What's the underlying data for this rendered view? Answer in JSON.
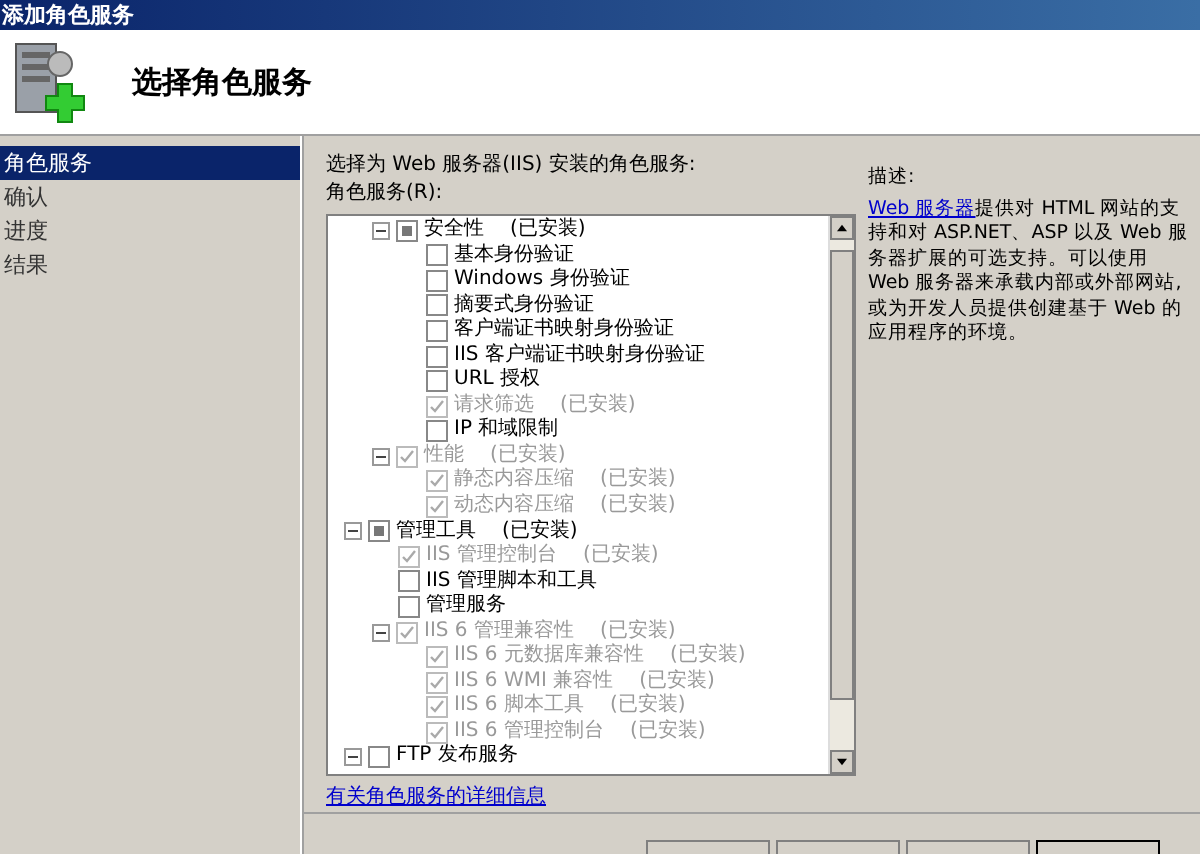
{
  "window": {
    "title": "添加角色服务"
  },
  "header": {
    "title": "选择角色服务"
  },
  "sidebar": {
    "items": [
      {
        "label": "角色服务",
        "selected": true
      },
      {
        "label": "确认",
        "selected": false
      },
      {
        "label": "进度",
        "selected": false
      },
      {
        "label": "结果",
        "selected": false
      }
    ]
  },
  "main": {
    "prompt": "选择为 Web 服务器(IIS) 安装的角色服务:",
    "list_label": "角色服务(R):",
    "tree": {
      "continued_children": [
        {
          "label": "安全性",
          "note": "(已安装)",
          "checked": false,
          "partial": true,
          "disabled": false,
          "expanded": true,
          "children": [
            {
              "label": "基本身份验证",
              "checked": false,
              "disabled": false
            },
            {
              "label": "Windows 身份验证",
              "checked": false,
              "disabled": false
            },
            {
              "label": "摘要式身份验证",
              "checked": false,
              "disabled": false
            },
            {
              "label": "客户端证书映射身份验证",
              "checked": false,
              "disabled": false
            },
            {
              "label": "IIS 客户端证书映射身份验证",
              "checked": false,
              "disabled": false
            },
            {
              "label": "URL 授权",
              "checked": false,
              "disabled": false
            },
            {
              "label": "请求筛选",
              "note": "(已安装)",
              "checked": true,
              "disabled": true
            },
            {
              "label": "IP 和域限制",
              "checked": false,
              "disabled": false
            }
          ]
        },
        {
          "label": "性能",
          "note": "(已安装)",
          "checked": true,
          "disabled": true,
          "expanded": true,
          "children": [
            {
              "label": "静态内容压缩",
              "note": "(已安装)",
              "checked": true,
              "disabled": true
            },
            {
              "label": "动态内容压缩",
              "note": "(已安装)",
              "checked": true,
              "disabled": true
            }
          ]
        }
      ],
      "items": [
        {
          "label": "管理工具",
          "note": "(已安装)",
          "checked": false,
          "partial": true,
          "disabled": false,
          "expanded": true,
          "children": [
            {
              "label": "IIS 管理控制台",
              "note": "(已安装)",
              "checked": true,
              "disabled": true
            },
            {
              "label": "IIS 管理脚本和工具",
              "checked": false,
              "disabled": false
            },
            {
              "label": "管理服务",
              "checked": false,
              "disabled": false
            },
            {
              "label": "IIS 6 管理兼容性",
              "note": "(已安装)",
              "checked": true,
              "disabled": true,
              "expanded": true,
              "children": [
                {
                  "label": "IIS 6 元数据库兼容性",
                  "note": "(已安装)",
                  "checked": true,
                  "disabled": true
                },
                {
                  "label": "IIS 6 WMI 兼容性",
                  "note": "(已安装)",
                  "checked": true,
                  "disabled": true
                },
                {
                  "label": "IIS 6 脚本工具",
                  "note": "(已安装)",
                  "checked": true,
                  "disabled": true
                },
                {
                  "label": "IIS 6 管理控制台",
                  "note": "(已安装)",
                  "checked": true,
                  "disabled": true
                }
              ]
            }
          ]
        },
        {
          "label": "FTP 发布服务",
          "checked": false,
          "disabled": false,
          "expanded": true
        }
      ]
    },
    "more_info_link": "有关角色服务的详细信息"
  },
  "description": {
    "title": "描述:",
    "link": "Web 服务器",
    "text": "提供对 HTML 网站的支持和对 ASP.NET、ASP 以及 Web 服务器扩展的可选支持。可以使用 Web 服务器来承载内部或外部网站,或为开发人员提供创建基于 Web 的应用程序的环境。"
  }
}
